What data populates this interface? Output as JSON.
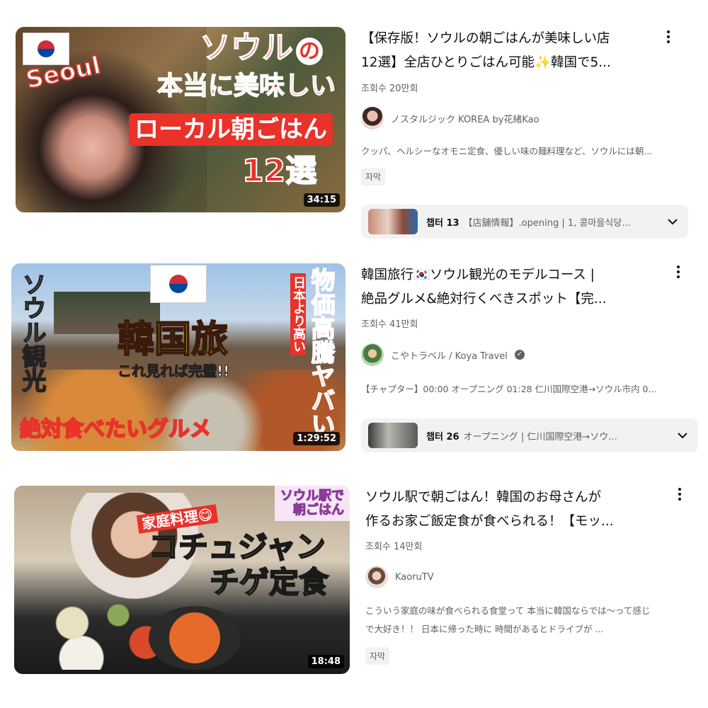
{
  "videos": [
    {
      "title_line1": "【保存版！ソウルの朝ごはんが美味しい店",
      "title_line2": "12選】全店ひとりごはん可能✨韓国で5...",
      "views": "조회수 20만회",
      "channel": "ノスタルジック KOREA by花緒Kao",
      "verified": false,
      "description": "クッパ、ヘルシーなオモニ定食、優しい味の麺料理など、ソウルには朝...",
      "badge": "자막",
      "chapter_label": "챕터 13",
      "chapter_text": "【店舗情報】.opening | 1, 콩마을식당...",
      "duration": "34:15",
      "thumb": {
        "seoul": "Seoul",
        "line1a": "ソウル",
        "line1b": "の",
        "line2": "本当に美味しい",
        "line3": "ローカル朝ごはん",
        "line4": "12選"
      }
    },
    {
      "title_line1": "韓国旅行🇰🇷ソウル観光のモデルコース |",
      "title_line2": "絶品グルメ&絶対行くべきスポット【完...",
      "views": "조회수 41만회",
      "channel": "こやトラベル / Koya Travel",
      "verified": true,
      "description": "【チャプター】00:00 オープニング 01:28 仁川国際空港→ソウル市内 0...",
      "chapter_label": "챕터 26",
      "chapter_text": "オープニング | 仁川国際空港→ソウ...",
      "duration": "1:29:52",
      "thumb": {
        "left_vertical": "ソウル観光",
        "main": "韓国旅",
        "sub": "これ見れば完璧!!",
        "right_vertical": "物価高騰ヤバい",
        "right_small": "日本より高い",
        "bottom": "絶対食べたいグルメ"
      }
    },
    {
      "title_line1": "ソウル駅で朝ごはん！韓国のお母さんが",
      "title_line2": "作るお家ご飯定食が食べられる！【モッ...",
      "views": "조회수 14만회",
      "channel": "KaoruTV",
      "verified": false,
      "description_line1": "こういう家庭の味が食べられる食堂って 本当に韓国ならでは～って感じ",
      "description_line2": "で大好き！！ 日本に帰った時に 時間があるとドライブが ...",
      "badge": "자막",
      "duration": "18:48",
      "thumb": {
        "corner1": "ソウル駅で",
        "corner2": "朝ごはん",
        "tag": "家庭料理😋",
        "main1": "コチュジャン",
        "main2": "チゲ定食"
      }
    }
  ],
  "icons": {
    "more": "more-vert-icon",
    "chevron": "chevron-down-icon",
    "verified": "verified-check-icon"
  },
  "colors": {
    "text_primary": "#0f0f0f",
    "text_secondary": "#606060",
    "chip_bg": "#f2f2f2"
  }
}
